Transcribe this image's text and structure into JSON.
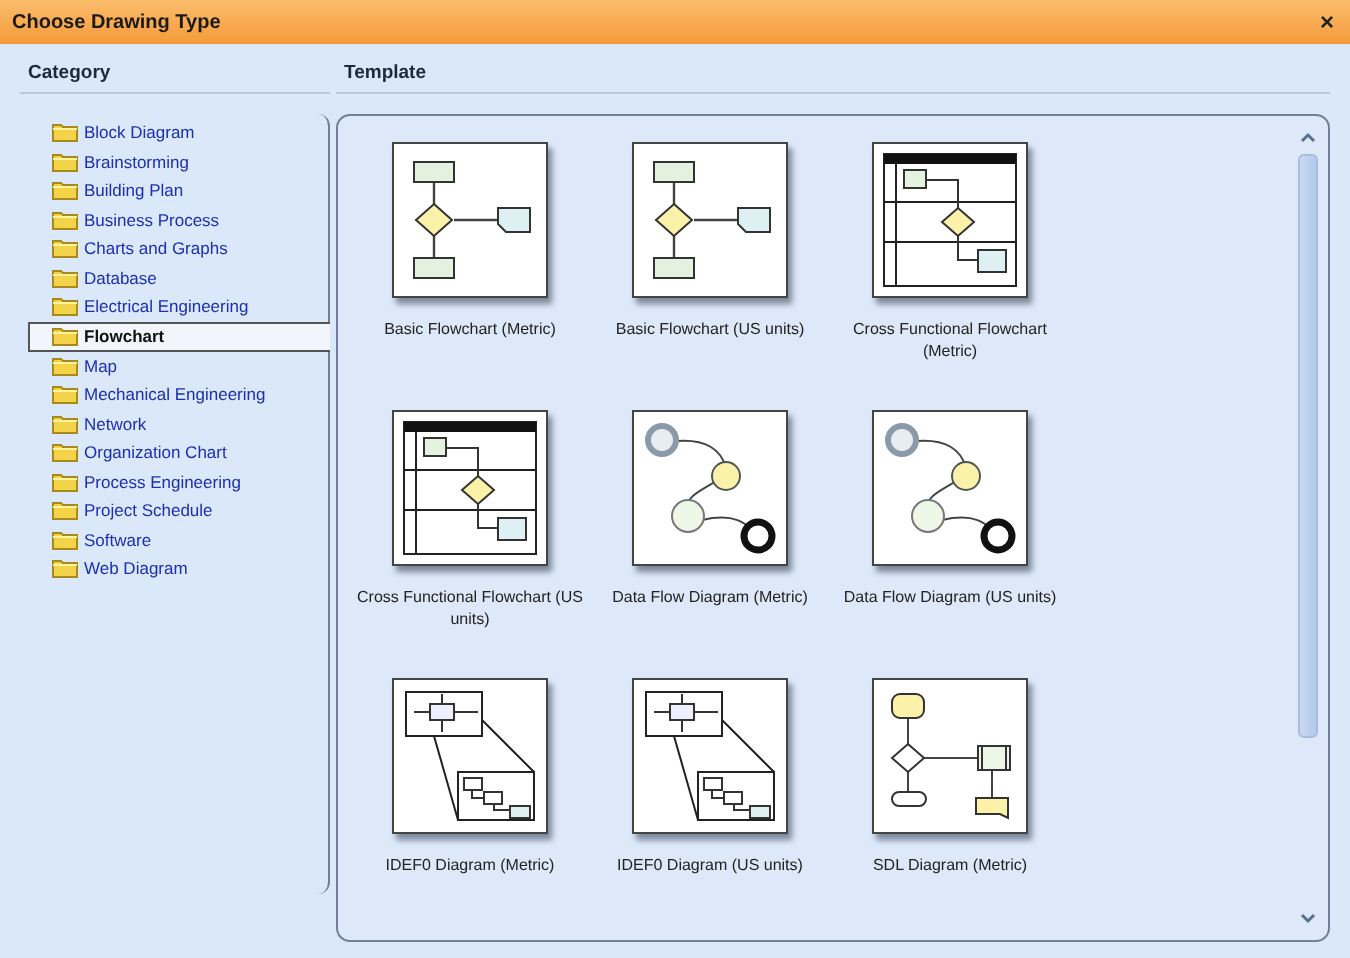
{
  "window": {
    "title": "Choose Drawing Type",
    "close": "×"
  },
  "category": {
    "heading": "Category",
    "items": [
      {
        "label": "Block Diagram",
        "selected": false
      },
      {
        "label": "Brainstorming",
        "selected": false
      },
      {
        "label": "Building Plan",
        "selected": false
      },
      {
        "label": "Business Process",
        "selected": false
      },
      {
        "label": "Charts and Graphs",
        "selected": false
      },
      {
        "label": "Database",
        "selected": false
      },
      {
        "label": "Electrical Engineering",
        "selected": false
      },
      {
        "label": "Flowchart",
        "selected": true
      },
      {
        "label": "Map",
        "selected": false
      },
      {
        "label": "Mechanical Engineering",
        "selected": false
      },
      {
        "label": "Network",
        "selected": false
      },
      {
        "label": "Organization Chart",
        "selected": false
      },
      {
        "label": "Process Engineering",
        "selected": false
      },
      {
        "label": "Project Schedule",
        "selected": false
      },
      {
        "label": "Software",
        "selected": false
      },
      {
        "label": "Web Diagram",
        "selected": false
      }
    ]
  },
  "template": {
    "heading": "Template",
    "items": [
      {
        "label": "Basic Flowchart (Metric)",
        "kind": "flowchart"
      },
      {
        "label": "Basic Flowchart (US units)",
        "kind": "flowchart"
      },
      {
        "label": "Cross Functional Flowchart (Metric)",
        "kind": "crossfunctional"
      },
      {
        "label": "Cross Functional Flowchart (US units)",
        "kind": "crossfunctional"
      },
      {
        "label": "Data Flow Diagram (Metric)",
        "kind": "dataflow"
      },
      {
        "label": "Data Flow Diagram (US units)",
        "kind": "dataflow"
      },
      {
        "label": "IDEF0 Diagram (Metric)",
        "kind": "idef0"
      },
      {
        "label": "IDEF0 Diagram (US units)",
        "kind": "idef0"
      },
      {
        "label": "SDL Diagram (Metric)",
        "kind": "sdl"
      }
    ]
  }
}
